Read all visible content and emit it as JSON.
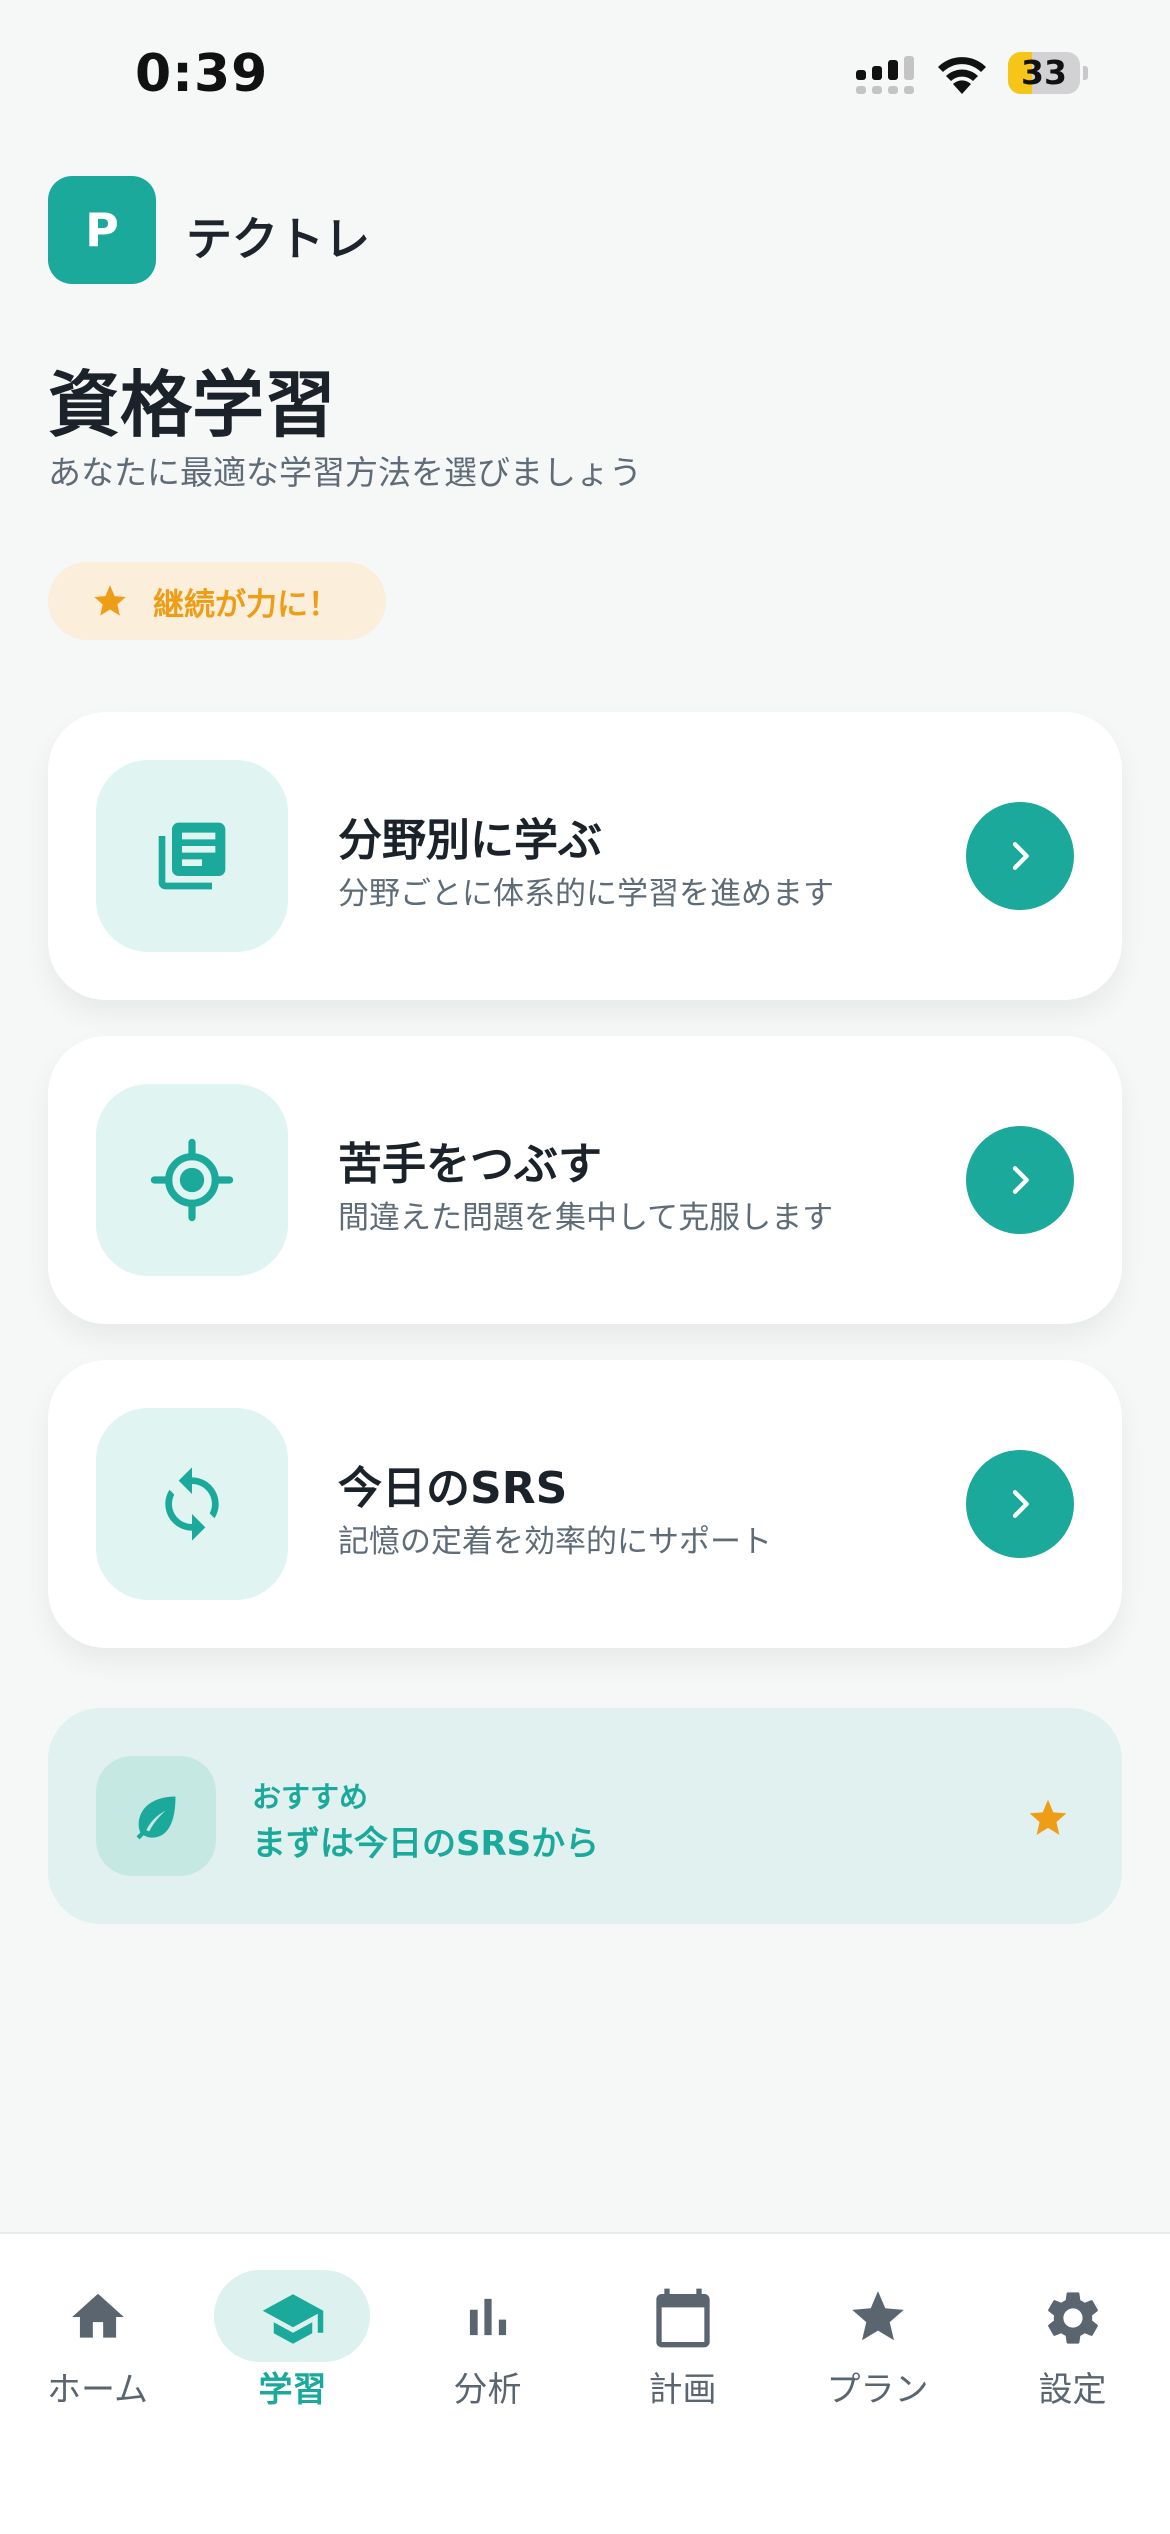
{
  "status_bar": {
    "time": "0:39",
    "battery": "33"
  },
  "header": {
    "logo_letter": "P",
    "app_name": "テクトレ"
  },
  "page": {
    "title": "資格学習",
    "subtitle": "あなたに最適な学習方法を選びましょう"
  },
  "motto": {
    "text": "継続が力に！"
  },
  "cards": [
    {
      "title": "分野別に学ぶ",
      "description": "分野ごとに体系的に学習を進めます",
      "icon": "library-books-icon"
    },
    {
      "title": "苦手をつぶす",
      "description": "間違えた問題を集中して克服します",
      "icon": "crosshair-target-icon"
    },
    {
      "title": "今日のSRS",
      "description": "記憶の定着を効率的にサポート",
      "icon": "sync-icon"
    }
  ],
  "recommend": {
    "label": "おすすめ",
    "text": "まずは今日のSRSから"
  },
  "nav": [
    {
      "label": "ホーム",
      "icon": "home-icon"
    },
    {
      "label": "学習",
      "icon": "graduation-cap-icon",
      "active": true
    },
    {
      "label": "分析",
      "icon": "bar-chart-icon"
    },
    {
      "label": "計画",
      "icon": "calendar-icon"
    },
    {
      "label": "プラン",
      "icon": "star-icon"
    },
    {
      "label": "設定",
      "icon": "gear-icon"
    }
  ],
  "colors": {
    "accent": "#1aa99a",
    "accent_light": "#e0f4f2",
    "warning": "#ee9d17",
    "background": "#f6f8f8"
  }
}
